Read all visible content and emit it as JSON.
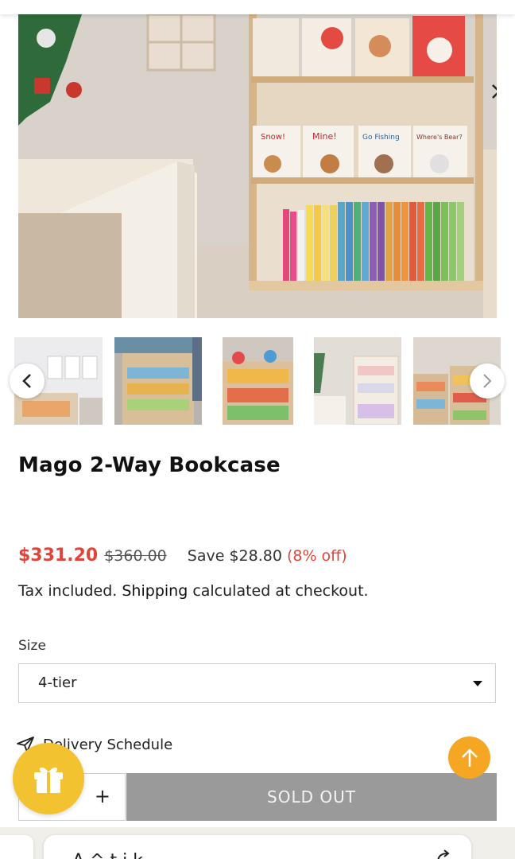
{
  "product": {
    "title": "Mago 2-Way Bookcase",
    "sale_price": "$331.20",
    "compare_price": "$360.00",
    "save_text": "Save $28.80",
    "save_pct": "(8% off)",
    "tax_text": "Tax included.",
    "shipping_link": "Shipping",
    "shipping_rest": "calculated at checkout."
  },
  "hero": {
    "book_titles_top": [
      "Snow!",
      "Mine!",
      "Go Fishing",
      "Where's Bear?"
    ]
  },
  "size": {
    "label": "Size",
    "selected": "4-tier"
  },
  "delivery": {
    "label": "Delivery Schedule"
  },
  "cart": {
    "qty_plus": "+",
    "soldout_label": "SOLD OUT"
  },
  "bottom": {
    "text": "A    ^ t    i  k"
  },
  "colors": {
    "sale": "#e0453a",
    "soldout_bg": "#9a9a9a",
    "gift": "#f2c230",
    "scroll_top": "#f5a623"
  },
  "icons": [
    "chevron-right-icon",
    "chevron-left-icon",
    "send-icon",
    "gift-icon",
    "arrow-up-icon",
    "share-icon"
  ]
}
